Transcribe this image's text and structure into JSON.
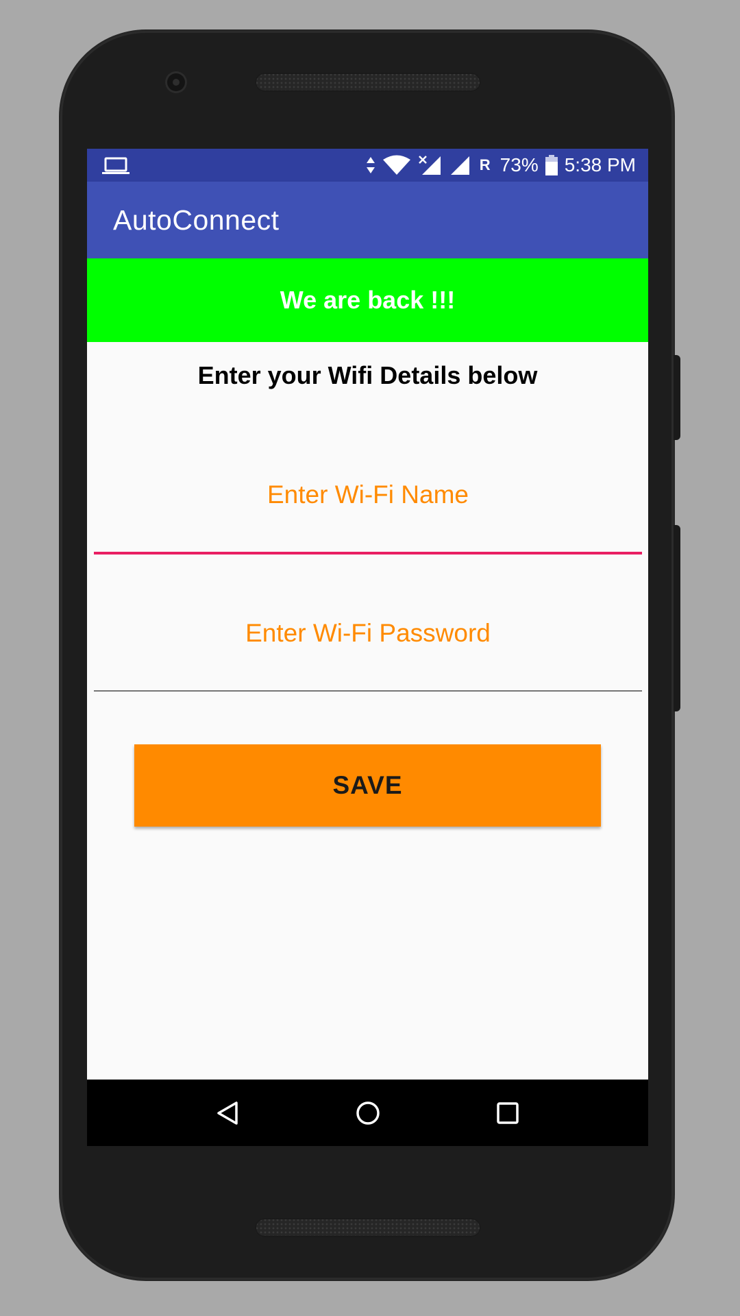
{
  "statusbar": {
    "battery_percent": "73%",
    "time": "5:38 PM",
    "roaming_indicator": "R",
    "icons": [
      "laptop-icon",
      "data-arrows-icon",
      "wifi-icon",
      "signal-no-data-icon",
      "signal-icon",
      "battery-icon"
    ]
  },
  "toolbar": {
    "title": "AutoConnect"
  },
  "banner": {
    "text": "We are back !!!",
    "color": "#00ff00"
  },
  "form": {
    "heading": "Enter your Wifi Details below",
    "wifi_name": {
      "value": "",
      "placeholder": "Enter Wi-Fi Name"
    },
    "wifi_password": {
      "value": "",
      "placeholder": "Enter Wi-Fi Password"
    },
    "save_label": "SAVE"
  },
  "colors": {
    "statusbar": "#303f9f",
    "toolbar": "#3f51b5",
    "accent_orange": "#ff8a00",
    "focus_underline": "#e91e63"
  },
  "navbar": {
    "icons": [
      "back-icon",
      "home-icon",
      "recents-icon"
    ]
  }
}
